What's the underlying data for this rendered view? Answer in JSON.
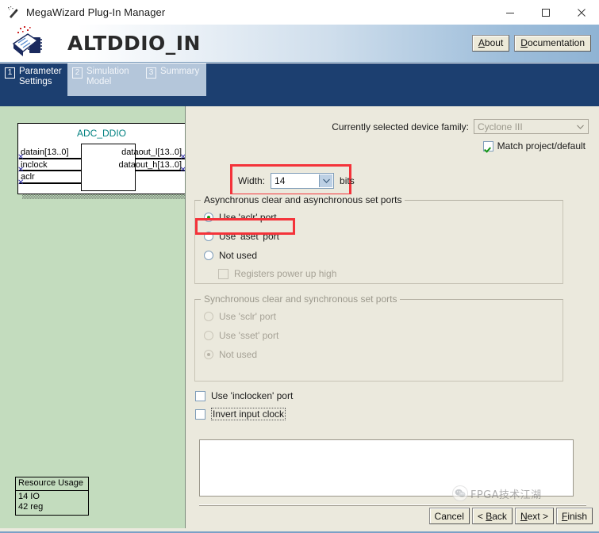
{
  "window": {
    "title": "MegaWizard Plug-In Manager",
    "icon": "wizard-wand-icon",
    "controls": {
      "minimize": "minimize-icon",
      "maximize": "maximize-icon",
      "close": "close-icon"
    }
  },
  "banner": {
    "logo": "altera-megafunction-icon",
    "title": "ALTDDIO_IN",
    "buttons": [
      {
        "label": "About",
        "accel": "A"
      },
      {
        "label": "Documentation",
        "accel": "D"
      }
    ]
  },
  "tabs": [
    {
      "number": "1",
      "label": "Parameter\nSettings",
      "active": true
    },
    {
      "number": "2",
      "label": "Simulation\nModel",
      "active": false
    },
    {
      "number": "3",
      "label": "Summary",
      "active": false
    }
  ],
  "preview": {
    "symbol_name": "ADC_DDIO",
    "inputs": [
      "datain[13..0]",
      "inclock",
      "aclr"
    ],
    "outputs": [
      "dataout_l[13..0]",
      "dataout_h[13..0]"
    ],
    "resource_usage": {
      "title": "Resource Usage",
      "lines": [
        "14 IO",
        "42 reg"
      ]
    }
  },
  "settings": {
    "device_family_label": "Currently selected device family:",
    "device_family_value": "Cyclone III",
    "match_project_label": "Match project/default",
    "match_project_checked": true,
    "width_label": "Width:",
    "width_value": "14",
    "width_units": "bits",
    "async_group": {
      "legend": "Asynchronus clear and asynchronous set ports",
      "options": [
        {
          "label": "Use 'aclr' port",
          "selected": true
        },
        {
          "label": "Use 'aset' port",
          "selected": false
        },
        {
          "label": "Not used",
          "selected": false
        }
      ],
      "power_up_label": "Registers power up high",
      "power_up_checked": false
    },
    "sync_group": {
      "legend": "Synchronous clear and synchronous set ports",
      "options": [
        {
          "label": "Use 'sclr' port",
          "selected": false
        },
        {
          "label": "Use 'sset' port",
          "selected": false
        },
        {
          "label": "Not used",
          "selected": true
        }
      ]
    },
    "checkboxes": [
      {
        "label": "Use 'inclocken' port",
        "checked": false,
        "focused": false
      },
      {
        "label": "Invert input clock",
        "checked": false,
        "focused": true
      }
    ]
  },
  "nav_buttons": [
    {
      "label": "Cancel",
      "accel": ""
    },
    {
      "label": "< Back",
      "accel": "B"
    },
    {
      "label": "Next >",
      "accel": "N"
    },
    {
      "label": "Finish",
      "accel": "F"
    }
  ],
  "watermark": {
    "icon": "wechat-icon",
    "text": "FPGA技术江湖"
  },
  "colors": {
    "banner_blue": "#8fb3d4",
    "tab_active": "#1c3f70",
    "tab_inactive": "#b4c6da",
    "panel_bg": "#ebe9dd",
    "preview_bg": "#c3dcbe",
    "symbol_label": "#008080",
    "highlight_red": "#f4333a",
    "radio_dot_green": "#149414"
  }
}
